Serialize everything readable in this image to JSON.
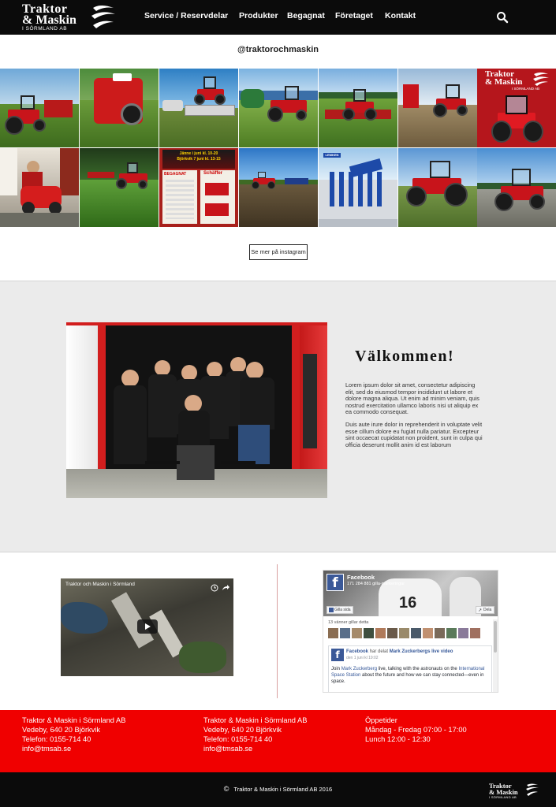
{
  "header": {
    "logo_line1": "Traktor",
    "logo_line2": "& Maskin",
    "logo_line3": "I SÖRMLAND AB",
    "nav": [
      "Service / Reservdelar",
      "Produkter",
      "Begagnat",
      "Företaget",
      "Kontakt"
    ],
    "search_icon": "search-icon"
  },
  "instagram": {
    "handle": "@traktorochmaskin",
    "more_label": "Se mer på instagram",
    "tile8_logo_line1": "Traktor",
    "tile8_logo_line2": "& Maskin",
    "tile8_logo_line3": "I SÖRMLAND AB",
    "poster_title1": "Jänne i juni kl. 10-20",
    "poster_title2": "Björkvik 7 juni kl. 13-15",
    "poster_begagnat": "BEGAGNAT",
    "poster_brand": "Schäffer",
    "brand_lemken": "LEMKEN"
  },
  "welcome": {
    "title": "Välkommen!",
    "paragraph1": "Lorem ipsum dolor sit amet, consectetur adipiscing elit, sed do eiusmod tempor incididunt ut labore et dolore magna aliqua. Ut enim ad minim veniam, quis nostrud exercitation ullamco laboris nisi ut aliquip ex ea commodo consequat.",
    "paragraph2": "Duis aute irure dolor in reprehenderit in voluptate velit esse cillum dolore eu fugiat nulla pariatur. Excepteur sint occaecat cupidatat non proident, sunt in culpa qui officia deserunt mollit anim id est laborum"
  },
  "video": {
    "title": "Traktor och Maskin i Sörmland"
  },
  "facebook": {
    "page_name": "Facebook",
    "likes_text": "171 284 881 gilla-markeringar",
    "like_button": "Gilla sida",
    "share_button": "Dela",
    "friends_text": "13 vänner gillar detta",
    "post_author": "Facebook",
    "post_action": "har delat",
    "post_shared": "Mark Zuckerbergs live video",
    "post_date": "den 1 juni kl 19:02",
    "post_text_1": "Join ",
    "post_link_1": "Mark Zuckerberg",
    "post_text_2": " live, talking with the astronauts on the ",
    "post_link_2": "International Space Station",
    "post_text_3": " about the future and how we can stay connected—even in space."
  },
  "footer": {
    "col1": [
      "Traktor & Maskin i Sörmland AB",
      "Vedeby, 640 20 Björkvik",
      "Telefon: 0155-714 40",
      "info@tmsab.se"
    ],
    "col2": [
      "Traktor & Maskin i Sörmland AB",
      "Vedeby, 640 20 Björkvik",
      "Telefon: 0155-714 40",
      "info@tmsab.se"
    ],
    "col3": [
      "Öppetider",
      "Måndag - Fredag 07:00 - 17:00",
      "Lunch 12:00 - 12:30"
    ],
    "copyright_symbol": "©",
    "copyright": "Traktor & Maskin i Sörmland AB 2016",
    "small_logo_line1": "Traktor",
    "small_logo_line2": "& Maskin",
    "small_logo_line3": "I SÖRMLAND AB"
  },
  "colors": {
    "header_bg": "#0b0b0b",
    "footer_red": "#f00000",
    "welcome_bg": "#ebebeb",
    "tractor_red": "#c8141b",
    "facebook_blue": "#3b5998"
  }
}
